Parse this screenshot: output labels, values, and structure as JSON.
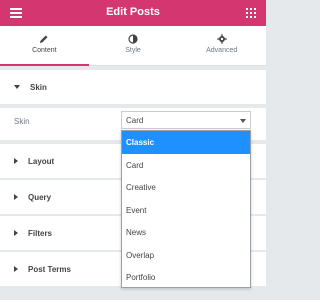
{
  "header": {
    "title": "Edit Posts"
  },
  "tabs": [
    {
      "label": "Content",
      "icon": "pencil-icon"
    },
    {
      "label": "Style",
      "icon": "half-circle-icon"
    },
    {
      "label": "Advanced",
      "icon": "gear-icon"
    }
  ],
  "sections": {
    "skin": {
      "title": "Skin"
    },
    "layout": {
      "title": "Layout"
    },
    "query": {
      "title": "Query"
    },
    "filters": {
      "title": "Filters"
    },
    "post_terms": {
      "title": "Post Terms"
    }
  },
  "skin_control": {
    "label": "Skin",
    "value": "Card",
    "options": [
      "Classic",
      "Card",
      "Creative",
      "Event",
      "News",
      "Overlap",
      "Portfolio"
    ],
    "highlighted": "Classic"
  },
  "colors": {
    "brand": "#d4366f",
    "highlight": "#1e90ff"
  }
}
